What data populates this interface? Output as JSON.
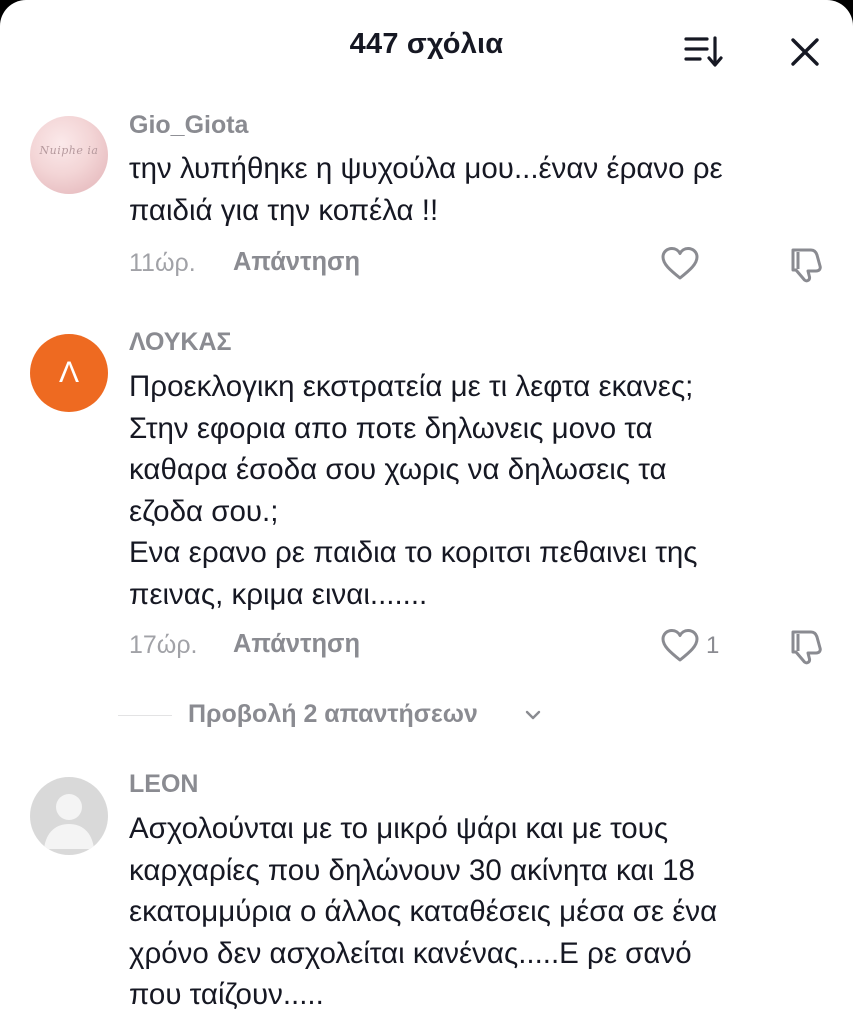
{
  "header": {
    "title": "447 σχόλια"
  },
  "comments": [
    {
      "username": "Gio_Giota",
      "avatar_text": "Nuiphe ia",
      "lines": [
        "την λυπήθηκε η ψυχούλα μου...έναν έρανο ρε",
        "παιδιά για την κοπέλα !!"
      ],
      "time": "11ώρ.",
      "reply_label": "Απάντηση",
      "likes": ""
    },
    {
      "username": "ΛΟΥΚΑΣ",
      "avatar_text": "Λ",
      "lines": [
        "Προεκλογικη εκστρατεία με τι λεφτα εκανες;",
        "Στην εφορια απο ποτε δηλωνεις μονο τα",
        "καθαρα έσοδα σου χωρις να δηλωσεις τα",
        "εζοδα σου.;",
        "Ενα ερανο ρε παιδια το κοριτσι πεθαινει της",
        "πεινας, κριμα ειναι......."
      ],
      "time": "17ώρ.",
      "reply_label": "Απάντηση",
      "likes": "1",
      "view_replies": "Προβολή 2 απαντήσεων"
    },
    {
      "username": "LEON",
      "lines": [
        "Ασχολούνται με το μικρό ψάρι και με τους",
        "καρχαρίες που δηλώνουν 30 ακίνητα και 18",
        "εκατομμύρια ο άλλος καταθέσεις μέσα σε ένα",
        "χρόνο δεν ασχολείται κανένας.....Ε ρε σανό",
        "που ταίζουν....."
      ]
    }
  ],
  "colors": {
    "primary_text": "#161823",
    "secondary_text": "#8a8b91",
    "avatar_orange": "#ee6a21",
    "avatar_gray": "#d9d9d9"
  },
  "icons": {
    "sort": "sort-icon",
    "close": "close-icon",
    "like": "heart-icon",
    "dislike": "thumbs-down-icon",
    "expand": "chevron-down-icon"
  }
}
